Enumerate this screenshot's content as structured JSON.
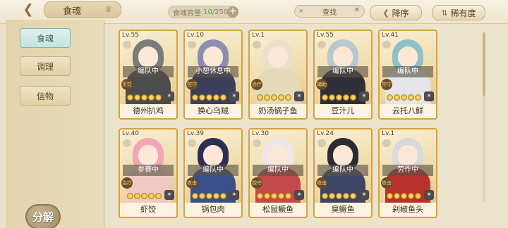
{
  "header": {
    "title": "食魂",
    "capacity_label": "食魂容量",
    "capacity_current": "10",
    "capacity_total": "/250",
    "search_label": "查找",
    "sort_label": "降序",
    "filter_label": "稀有度"
  },
  "sidebar": {
    "tabs": [
      {
        "label": "食魂",
        "active": true
      },
      {
        "label": "调理",
        "active": false
      },
      {
        "label": "信物",
        "active": false
      }
    ],
    "decompose_label": "分解"
  },
  "cards": [
    {
      "level": "Lv.55",
      "status": "编队中",
      "name": "德州扒鸡",
      "badge": "烹饪",
      "stars": 5
    },
    {
      "level": "Lv.10",
      "status": "小憩休息中",
      "name": "换心乌贼",
      "badge": "控守",
      "stars": 5
    },
    {
      "level": "Lv.1",
      "status": "",
      "name": "奶汤锅子鱼",
      "badge": "治疗",
      "stars": 5
    },
    {
      "level": "Lv.55",
      "status": "编队中",
      "name": "豆汁儿",
      "badge": "辅助",
      "stars": 5
    },
    {
      "level": "Lv.41",
      "status": "编队中",
      "name": "云托八鲜",
      "badge": "控守",
      "stars": 5
    },
    {
      "level": "Lv.40",
      "status": "参赛中",
      "name": "虾饺",
      "badge": "治疗",
      "stars": 5
    },
    {
      "level": "Lv.39",
      "status": "编队中",
      "name": "锅包肉",
      "badge": "攻击",
      "stars": 5
    },
    {
      "level": "Lv.30",
      "status": "编队中",
      "name": "松鼠鳜鱼",
      "badge": "控守",
      "stars": 5
    },
    {
      "level": "Lv.24",
      "status": "编队中",
      "name": "臭鳜鱼",
      "badge": "攻击",
      "stars": 5
    },
    {
      "level": "Lv.1",
      "status": "劳作中",
      "name": "剁椒鱼头",
      "badge": "攻击",
      "stars": 5
    }
  ],
  "colors": {
    "card_border": "#d6a23a",
    "accent": "#7fb3a6"
  }
}
